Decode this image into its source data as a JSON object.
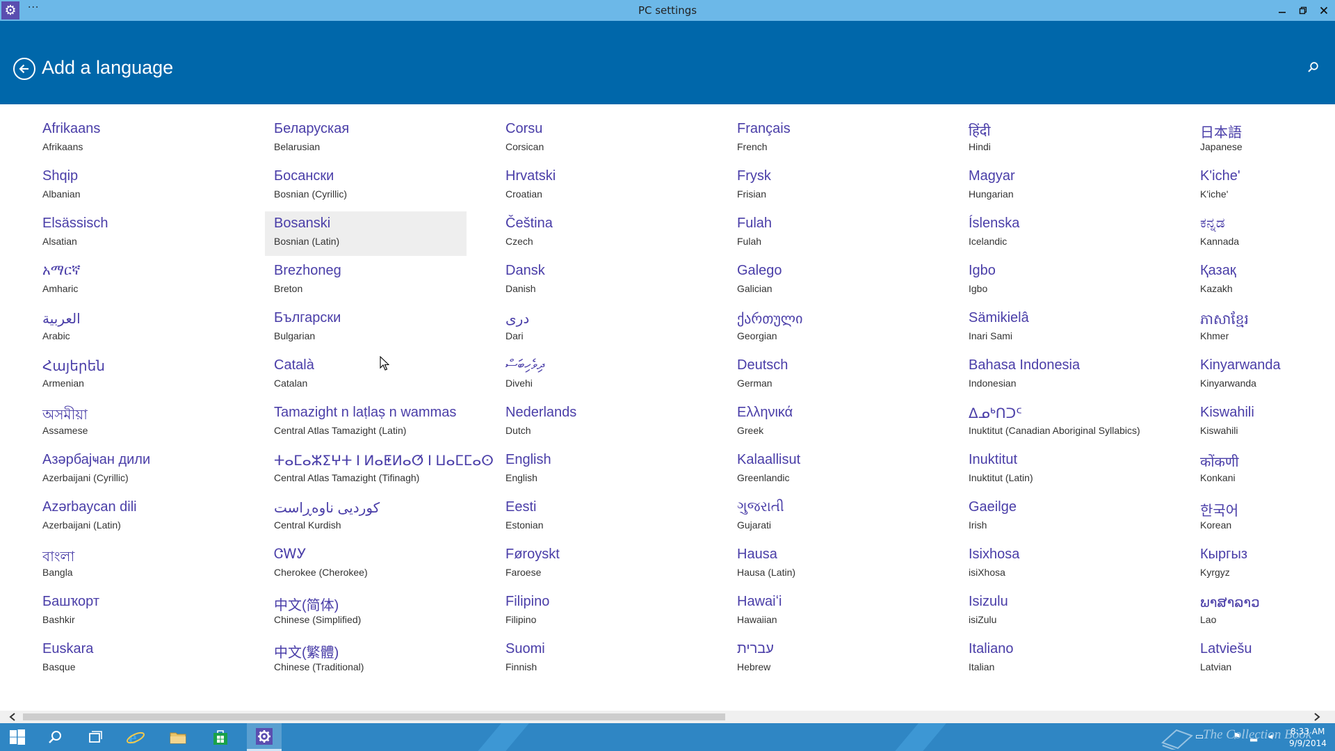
{
  "window": {
    "title": "PC settings",
    "dots": "···",
    "minimize_icon": "minimize-icon",
    "restore_icon": "restore-icon",
    "close_icon": "close-icon"
  },
  "header": {
    "title": "Add a language",
    "back_icon": "back-arrow-icon",
    "search_icon": "search-icon",
    "background": "#0067aa"
  },
  "columns": [
    [
      {
        "native": "Afrikaans",
        "english": "Afrikaans"
      },
      {
        "native": "Shqip",
        "english": "Albanian"
      },
      {
        "native": "Elsässisch",
        "english": "Alsatian"
      },
      {
        "native": "አማርኛ",
        "english": "Amharic"
      },
      {
        "native": "العربية",
        "english": "Arabic"
      },
      {
        "native": "Հայերեն",
        "english": "Armenian"
      },
      {
        "native": "অসমীয়া",
        "english": "Assamese"
      },
      {
        "native": "Азәрбајҹан дили",
        "english": "Azerbaijani (Cyrillic)"
      },
      {
        "native": "Azərbaycan dili",
        "english": "Azerbaijani (Latin)"
      },
      {
        "native": "বাংলা",
        "english": "Bangla"
      },
      {
        "native": "Башҡорт",
        "english": "Bashkir"
      },
      {
        "native": "Euskara",
        "english": "Basque"
      }
    ],
    [
      {
        "native": "Беларуская",
        "english": "Belarusian"
      },
      {
        "native": "Босански",
        "english": "Bosnian (Cyrillic)"
      },
      {
        "native": "Bosanski",
        "english": "Bosnian (Latin)",
        "hovered": true
      },
      {
        "native": "Brezhoneg",
        "english": "Breton"
      },
      {
        "native": "Български",
        "english": "Bulgarian"
      },
      {
        "native": "Català",
        "english": "Catalan"
      },
      {
        "native": "Tamazight n laṭlaṣ n wammas",
        "english": "Central Atlas Tamazight (Latin)"
      },
      {
        "native": "ⵜⴰⵎⴰⵣⵉⵖⵜ ⵏ ⵍⴰⵟⵍⴰⵚ ⵏ ⵡⴰⵎⵎⴰⵙ",
        "english": "Central Atlas Tamazight (Tifinagh)"
      },
      {
        "native": "کوردیی ناوەڕاست",
        "english": "Central Kurdish"
      },
      {
        "native": "ᏣᎳᎩ",
        "english": "Cherokee (Cherokee)"
      },
      {
        "native": "中文(简体)",
        "english": "Chinese (Simplified)"
      },
      {
        "native": "中文(繁體)",
        "english": "Chinese (Traditional)"
      }
    ],
    [
      {
        "native": "Corsu",
        "english": "Corsican"
      },
      {
        "native": "Hrvatski",
        "english": "Croatian"
      },
      {
        "native": "Čeština",
        "english": "Czech"
      },
      {
        "native": "Dansk",
        "english": "Danish"
      },
      {
        "native": "درى",
        "english": "Dari"
      },
      {
        "native": "ދިވެހިބަސް",
        "english": "Divehi"
      },
      {
        "native": "Nederlands",
        "english": "Dutch"
      },
      {
        "native": "English",
        "english": "English"
      },
      {
        "native": "Eesti",
        "english": "Estonian"
      },
      {
        "native": "Føroyskt",
        "english": "Faroese"
      },
      {
        "native": "Filipino",
        "english": "Filipino"
      },
      {
        "native": "Suomi",
        "english": "Finnish"
      }
    ],
    [
      {
        "native": "Français",
        "english": "French"
      },
      {
        "native": "Frysk",
        "english": "Frisian"
      },
      {
        "native": "Fulah",
        "english": "Fulah"
      },
      {
        "native": "Galego",
        "english": "Galician"
      },
      {
        "native": "ქართული",
        "english": "Georgian"
      },
      {
        "native": "Deutsch",
        "english": "German"
      },
      {
        "native": "Ελληνικά",
        "english": "Greek"
      },
      {
        "native": "Kalaallisut",
        "english": "Greenlandic"
      },
      {
        "native": "ગુજરાતી",
        "english": "Gujarati"
      },
      {
        "native": "Hausa",
        "english": "Hausa (Latin)"
      },
      {
        "native": "Hawaiʻi",
        "english": "Hawaiian"
      },
      {
        "native": "עברית",
        "english": "Hebrew"
      }
    ],
    [
      {
        "native": "हिंदी",
        "english": "Hindi"
      },
      {
        "native": "Magyar",
        "english": "Hungarian"
      },
      {
        "native": "Íslenska",
        "english": "Icelandic"
      },
      {
        "native": "Igbo",
        "english": "Igbo"
      },
      {
        "native": "Sämikielâ",
        "english": "Inari Sami"
      },
      {
        "native": "Bahasa Indonesia",
        "english": "Indonesian"
      },
      {
        "native": "ᐃᓄᒃᑎᑐᑦ",
        "english": "Inuktitut (Canadian Aboriginal Syllabics)"
      },
      {
        "native": "Inuktitut",
        "english": "Inuktitut (Latin)"
      },
      {
        "native": "Gaeilge",
        "english": "Irish"
      },
      {
        "native": "Isixhosa",
        "english": "isiXhosa"
      },
      {
        "native": "Isizulu",
        "english": "isiZulu"
      },
      {
        "native": "Italiano",
        "english": "Italian"
      }
    ],
    [
      {
        "native": "日本語",
        "english": "Japanese"
      },
      {
        "native": "K'iche'",
        "english": "K'iche'"
      },
      {
        "native": "ಕನ್ನಡ",
        "english": "Kannada"
      },
      {
        "native": "Қазақ",
        "english": "Kazakh"
      },
      {
        "native": "ភាសាខ្មែរ",
        "english": "Khmer"
      },
      {
        "native": "Kinyarwanda",
        "english": "Kinyarwanda"
      },
      {
        "native": "Kiswahili",
        "english": "Kiswahili"
      },
      {
        "native": "कोंकणी",
        "english": "Konkani"
      },
      {
        "native": "한국어",
        "english": "Korean"
      },
      {
        "native": "Кыргыз",
        "english": "Kyrgyz"
      },
      {
        "native": "ພາສາລາວ",
        "english": "Lao"
      },
      {
        "native": "Latviešu",
        "english": "Latvian"
      }
    ]
  ],
  "scrollbar": {
    "left_icon": "scroll-left-arrow-icon",
    "right_icon": "scroll-right-arrow-icon",
    "position": 0.02,
    "visible_fraction": 0.53
  },
  "taskbar": {
    "items": [
      {
        "name": "start-button",
        "icon": "windows-logo-icon"
      },
      {
        "name": "search-button",
        "icon": "search-icon"
      },
      {
        "name": "task-view-button",
        "icon": "task-view-icon"
      },
      {
        "name": "internet-explorer-button",
        "icon": "internet-explorer-icon"
      },
      {
        "name": "file-explorer-button",
        "icon": "folder-icon"
      },
      {
        "name": "store-button",
        "icon": "store-icon"
      },
      {
        "name": "pc-settings-button",
        "icon": "gear-icon",
        "active": true
      }
    ],
    "watermark": "The Collection Book",
    "clock_time": "8:33 AM",
    "clock_date": "9/9/2014",
    "background": "#2f86c4"
  }
}
